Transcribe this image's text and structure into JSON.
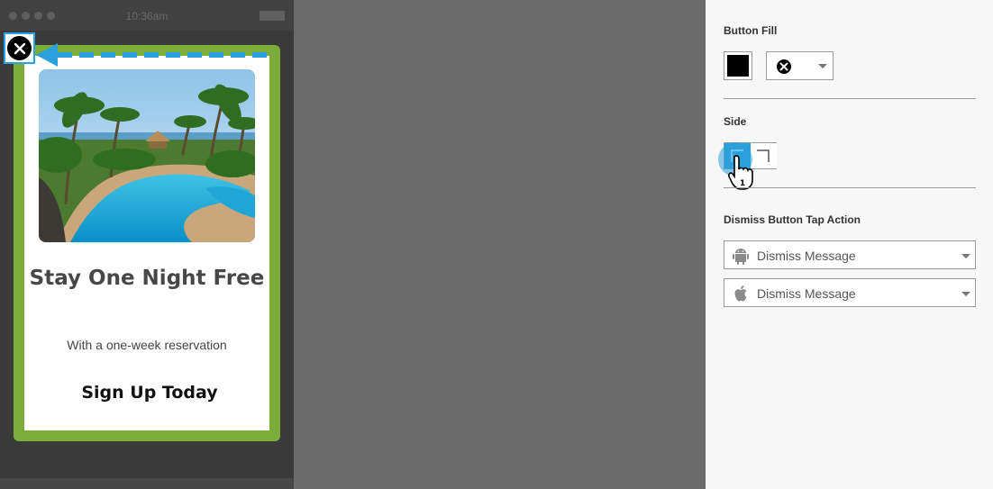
{
  "phone": {
    "status_time": "10:36am"
  },
  "message": {
    "headline": "Stay One Night Free",
    "subtitle": "With a one-week reservation",
    "cta": "Sign Up Today"
  },
  "panel": {
    "button_fill_label": "Button Fill",
    "button_fill_color": "#000000",
    "side_label": "Side",
    "side_selected": "left",
    "dismiss_label": "Dismiss Button Tap Action",
    "android_action": "Dismiss Message",
    "ios_action": "Dismiss Message",
    "cursor_badge": "1"
  },
  "colors": {
    "accent": "#2aa1dd",
    "frame_green": "#7cad3b"
  },
  "icons": [
    "close-icon",
    "arrow-left-icon",
    "android-icon",
    "apple-icon",
    "pointer-hand-icon"
  ]
}
